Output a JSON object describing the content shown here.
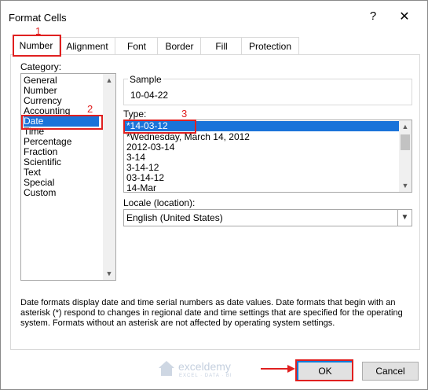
{
  "window": {
    "title": "Format Cells",
    "help_glyph": "?",
    "close_glyph": "✕"
  },
  "tabs": [
    "Number",
    "Alignment",
    "Font",
    "Border",
    "Fill",
    "Protection"
  ],
  "category": {
    "label": "Category:",
    "items": [
      "General",
      "Number",
      "Currency",
      "Accounting",
      "Date",
      "Time",
      "Percentage",
      "Fraction",
      "Scientific",
      "Text",
      "Special",
      "Custom"
    ],
    "selected": "Date"
  },
  "sample": {
    "label": "Sample",
    "value": "10-04-22"
  },
  "type": {
    "label": "Type:",
    "items": [
      "*14-03-12",
      "*Wednesday, March 14, 2012",
      "2012-03-14",
      "3-14",
      "3-14-12",
      "03-14-12",
      "14-Mar"
    ],
    "selected": "*14-03-12"
  },
  "locale": {
    "label": "Locale (location):",
    "value": "English (United States)"
  },
  "description": "Date formats display date and time serial numbers as date values.  Date formats that begin with an asterisk (*) respond to changes in regional date and time settings that are specified for the operating system. Formats without an asterisk are not affected by operating system settings.",
  "buttons": {
    "ok": "OK",
    "cancel": "Cancel"
  },
  "annotations": {
    "step1": "1",
    "step2": "2",
    "step3": "3"
  },
  "watermark": {
    "name": "exceldemy",
    "tagline": "EXCEL · DATA · BI"
  },
  "colors": {
    "selection": "#1a73d9",
    "annotation": "#e02020",
    "ok_border": "#0078d7"
  },
  "icons": {
    "help": "question-mark",
    "close": "x-mark",
    "dropdown": "chevron-down",
    "scroll_up": "caret-up",
    "scroll_down": "caret-down"
  }
}
